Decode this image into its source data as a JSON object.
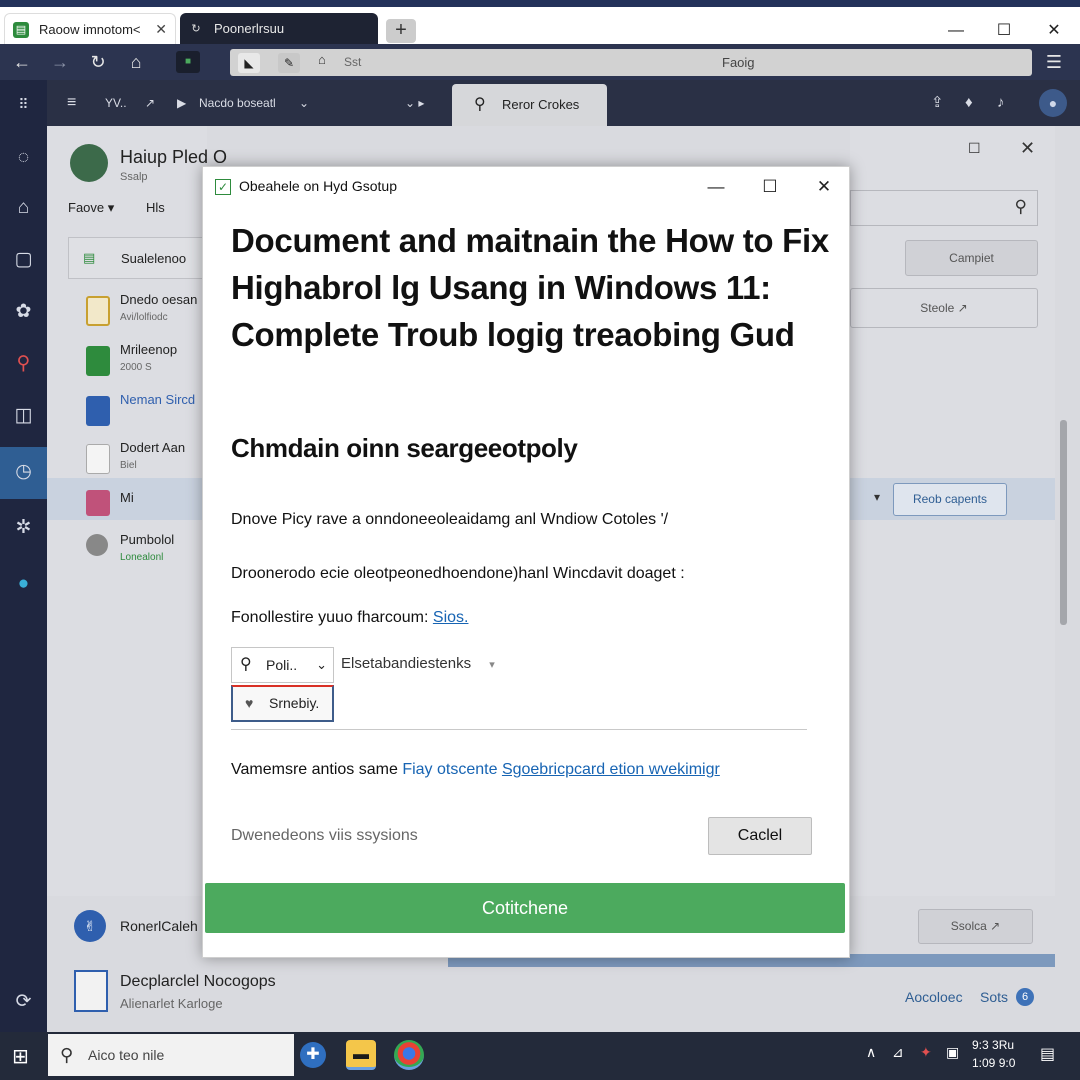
{
  "browser": {
    "tabs": [
      {
        "label": "Raoow imnotom<",
        "close": "✕"
      },
      {
        "label": "Poonerlrsuu"
      }
    ],
    "new_tab": "+",
    "window_controls": [
      "—",
      "☐",
      "✕"
    ],
    "address": "Faoig",
    "address_prefix": "Sst",
    "menu_icon": "☰"
  },
  "app": {
    "header": {
      "menu": "≡",
      "crumb1": "YV..",
      "crumb2": "Nacdo boseatl",
      "search_tab": "Reror Crokes"
    },
    "panel": {
      "title": "Haiup Pled O",
      "subtitle": "Ssalp",
      "filter1": "Faove",
      "filter2": "Hls",
      "search_item": "Sualelenoo"
    },
    "list": [
      {
        "title": "Dnedo oesan",
        "sub": "Avi/lolfiodc"
      },
      {
        "title": "Mrileenop",
        "sub": "2000 S"
      },
      {
        "title": "Neman Sircd",
        "sub": ""
      },
      {
        "title": "Dodert Aan",
        "sub": "Biel"
      },
      {
        "title": "Mi",
        "sub": ""
      },
      {
        "title": "Pumbolol",
        "sub": "Lonealonl"
      }
    ],
    "right_buttons": {
      "compute": "Campiet",
      "steole": "Steole",
      "reob": "Reob capents",
      "ssolca": "Ssolca"
    },
    "bottom_items": [
      {
        "title": "RonerlCaleh",
        "sub": ""
      },
      {
        "title": "Decplarclel Nocogops",
        "sub": "Alienarlet Karloge"
      }
    ],
    "footer_link": "Aocoloec",
    "footer_link2": "Sots",
    "footer_badge": "6"
  },
  "dialog": {
    "title": "Obeahele on Hyd Gsotup",
    "controls": [
      "—",
      "☐",
      "✕"
    ],
    "heading": "Document and maitnain the How to Fix Highabrol lg Usang in Windows 11: Complete Troub   logig treaobing Gud",
    "subheading": "Chmdain oinn seargeeotpoly",
    "para1": "Dnove Picy rave a onndoneeoleaidamg anl Wndiow Cotoles '/",
    "para2": "Droonerodo ecie oleotpeonedhoendone)hanl Wincdavit doaget :",
    "para3_text": "Fonollestire yuuo fharcoum:",
    "para3_link": "Sios.",
    "select1": "Poli..",
    "select2": "Elsetabandiestenks",
    "select3": "Srnebiy.",
    "para4_text": "Vamemsre antios same",
    "para4_link1": "Fiay otscente",
    "para4_link2": "Sgoebricpcard etion wvekimigr",
    "footnote": "Dwenedeons viis ssysions",
    "cancel": "Caclel",
    "primary": "Cotitchene"
  },
  "taskbar": {
    "search_placeholder": "Aico teo nile",
    "time": "9:3 3Ru",
    "date": "1:09 9:0"
  },
  "colors": {
    "accent": "#4caa5e",
    "link": "#1764b3",
    "chrome": "#2c3450"
  }
}
